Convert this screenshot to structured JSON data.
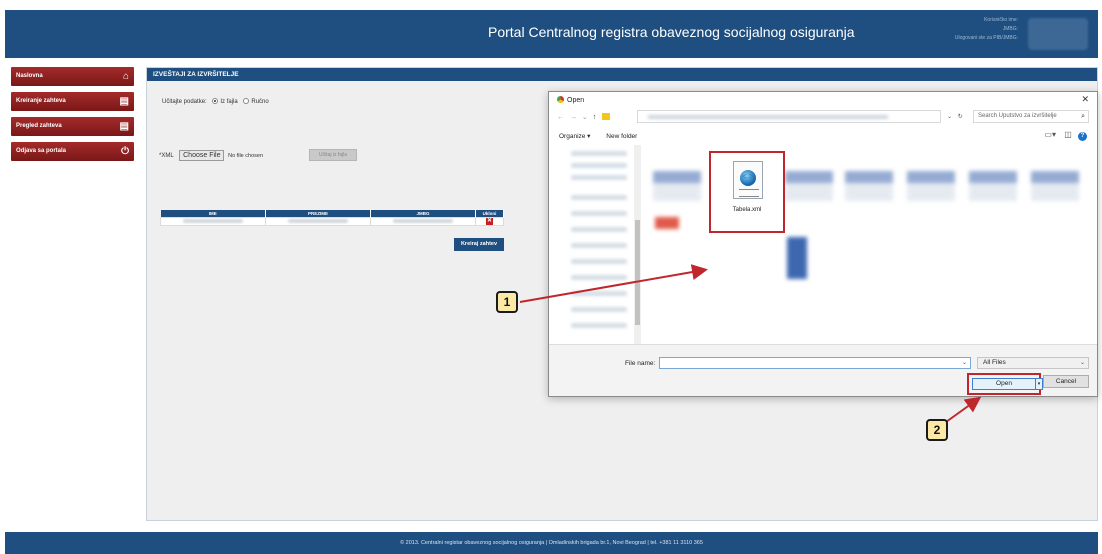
{
  "header": {
    "title": "Portal Centralnog registra obaveznog socijalnog osiguranja",
    "user_lines": [
      "Korisničko ime:",
      "JMBG:",
      "Ulogovani ste za PIB/JMBG:"
    ]
  },
  "sidebar": {
    "items": [
      {
        "label": "Naslovna",
        "icon": "home-icon"
      },
      {
        "label": "Kreiranje zahteva",
        "icon": "document-icon"
      },
      {
        "label": "Pregled zahteva",
        "icon": "document-icon"
      },
      {
        "label": "Odjava sa portala",
        "icon": "power-icon"
      }
    ]
  },
  "main": {
    "title": "IZVEŠTAJI ZA IZVRŠITELJE",
    "load_label": "Učitajte podatke:",
    "radio_file": "Iz fajla",
    "radio_manual": "Ručno",
    "xml_label": "*XML",
    "choose_file": "Choose File",
    "no_file": "No file chosen",
    "load_button": "Učitaj iz fajla",
    "table_headers": [
      "IME",
      "PREZIME",
      "JMBG",
      "Ukloni"
    ],
    "create_button": "Kreiraj zahtev"
  },
  "dialog": {
    "title": "Open",
    "search_placeholder": "Search Uputstvo za izvršitelje",
    "organize": "Organize ▾",
    "new_folder": "New folder",
    "file_name": "Tabela.xml",
    "file_name_label": "File name:",
    "filter": "All Files",
    "open_button": "Open",
    "cancel_button": "Cancel"
  },
  "callouts": {
    "one": "1",
    "two": "2"
  },
  "footer": {
    "text": "© 2013. Centralni registar obaveznog socijalnog osiguranja | Omladinskih brigada br.1, Novi Beograd | tel. +381 11 3110 365"
  },
  "colors": {
    "header_blue": "#1f4f80",
    "sidebar_red": "#8e1f1f",
    "highlight_red": "#c0272d",
    "callout_fill": "#fde9a6"
  }
}
